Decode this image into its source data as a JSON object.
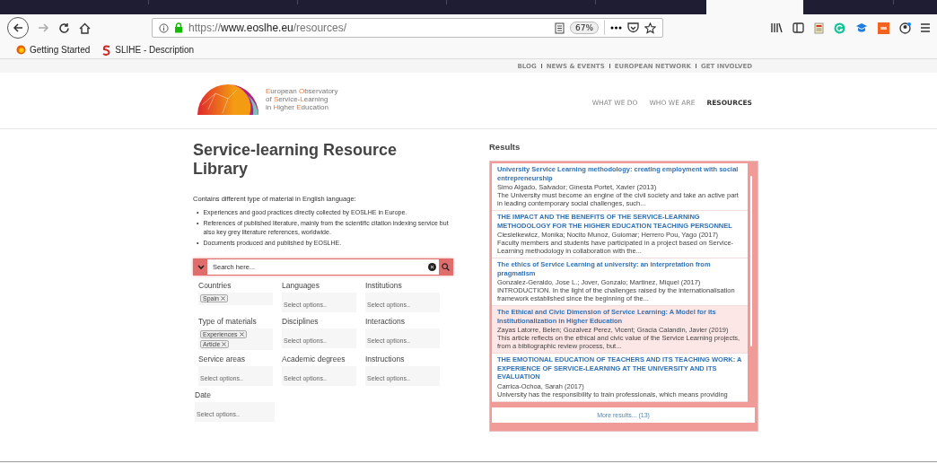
{
  "browser": {
    "url": "https://**www.eoslhe.eu**/resources/",
    "zoom": "67%"
  },
  "bookmarks": [
    {
      "label": "Getting Started",
      "kind": "firefox"
    },
    {
      "label": "SLIHE - Description",
      "kind": "slihe"
    }
  ],
  "top_links": [
    "BLOG",
    "NEWS & EVENTS",
    "EUROPEAN NETWORK",
    "GET INVOLVED"
  ],
  "logo_text": [
    "European Observatory",
    "of Service-Learning",
    "in Higher Education"
  ],
  "nav": [
    {
      "label": "WHAT WE DO",
      "selected": false
    },
    {
      "label": "WHO WE ARE",
      "selected": false
    },
    {
      "label": "RESOURCES",
      "selected": true
    }
  ],
  "intro": {
    "marker": "•",
    "title": "Service-learning Resource Library",
    "lead": "Contains different type of material in English language:",
    "bullets": [
      "Experiences and good practices directly collected by EOSLHE in Europe.",
      "References of published literature, mainly from the scientific citation indexing service but also key grey literature references, worldwide.",
      "Documents produced and published by EOSLHE."
    ]
  },
  "search": {
    "placeholder": "Search here..."
  },
  "filters": [
    {
      "label": "Countries",
      "tags": [
        "Spain"
      ]
    },
    {
      "label": "Languages",
      "placeholder": "Select options.."
    },
    {
      "label": "Institutions",
      "placeholder": "Select options.."
    },
    {
      "label": "Type of materials",
      "tags": [
        "Experiences",
        "Article"
      ]
    },
    {
      "label": "Disciplines",
      "placeholder": "Select options.."
    },
    {
      "label": "Interactions",
      "placeholder": "Select options.."
    },
    {
      "label": "Service areas",
      "placeholder": "Select options.."
    },
    {
      "label": "Academic degrees",
      "placeholder": "Select options.."
    },
    {
      "label": "Instructions",
      "placeholder": "Select options.."
    },
    {
      "label": "Date",
      "placeholder": "Select options.."
    }
  ],
  "results": {
    "heading": "Results",
    "items": [
      {
        "title": "University Service Learning methodology: creating employment with social entrepreneurship",
        "authors": "Simo Algado, Salvador; Ginesta Portet, Xavier (2013)",
        "snippet": "The University must become an engine of the civil society and take an active part in leading contemporary social challenges, such...",
        "selected": false
      },
      {
        "title": "THE IMPACT AND THE BENEFITS OF THE SERVICE-LEARNING METHODOLOGY FOR THE HIGHER EDUCATION TEACHING PERSONNEL",
        "authors": "Ciesielkewicz, Monika; Nocito Munoz, Guiomar; Herrero Pou, Yago (2017)",
        "snippet": "Faculty members and students have participated in a project based on Service-Learning methodology in collaboration with the...",
        "selected": false
      },
      {
        "title": "The ethics of Service Learning at university: an interpretation from pragmatism",
        "authors": "Gonzalez-Geraldo, Jose L.; Jover, Gonzalo; Martinez, Miquel (2017)",
        "snippet": "INTRODUCTION. In the light of the challenges raised by the internationalisation framework established since the beginning of the...",
        "selected": false
      },
      {
        "title": "The Ethical and Civic Dimension of Service Learning: A Model for its Institutionalization in Higher Education",
        "authors": "Zayas Latorre, Belen; Gozalvez Perez, Vicent; Gracia Calandin, Javier (2019)",
        "snippet": "This article reflects on the ethical and civic value of the Service Learning projects, from a bibliographic review process, but...",
        "selected": true
      },
      {
        "title": "THE EMOTIONAL EDUCATION OF TEACHERS AND ITS TEACHING WORK: A EXPERIENCE OF SERVICE-LEARNING AT THE UNIVERSITY AND ITS EVALUATION",
        "authors": "Carrica-Ochoa, Sarah (2017)",
        "snippet": "University has the responsibility to train professionals, which means providing",
        "selected": false
      }
    ],
    "more": "More results... (13)"
  }
}
